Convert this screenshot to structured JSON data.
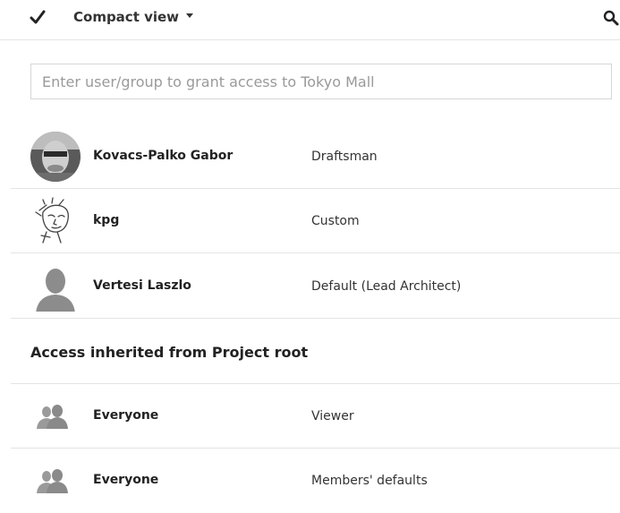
{
  "toolbar": {
    "view_label": "Compact view",
    "icons": {
      "check": "checkmark-icon",
      "search": "search-icon",
      "dropdown": "caret-down-icon"
    }
  },
  "grant_input": {
    "placeholder": "Enter user/group to grant access to Tokyo Mall",
    "value": ""
  },
  "direct_access": [
    {
      "name": "Kovacs-Palko Gabor",
      "role": "Draftsman",
      "avatar": "photo-avatar"
    },
    {
      "name": "kpg",
      "role": "Custom",
      "avatar": "sketch-avatar"
    },
    {
      "name": "Vertesi Laszlo",
      "role": "Default  (Lead Architect)",
      "avatar": "default-user-avatar"
    }
  ],
  "inherited": {
    "heading": "Access inherited from Project root",
    "rows": [
      {
        "name": "Everyone",
        "role": "Viewer",
        "avatar": "group-icon"
      },
      {
        "name": "Everyone",
        "role": "Members' defaults",
        "avatar": "group-icon"
      }
    ]
  },
  "colors": {
    "text": "#333333",
    "separator": "#e4e4e4",
    "placeholder": "#9a9a9a",
    "avatar_gray": "#8c8c8c"
  }
}
